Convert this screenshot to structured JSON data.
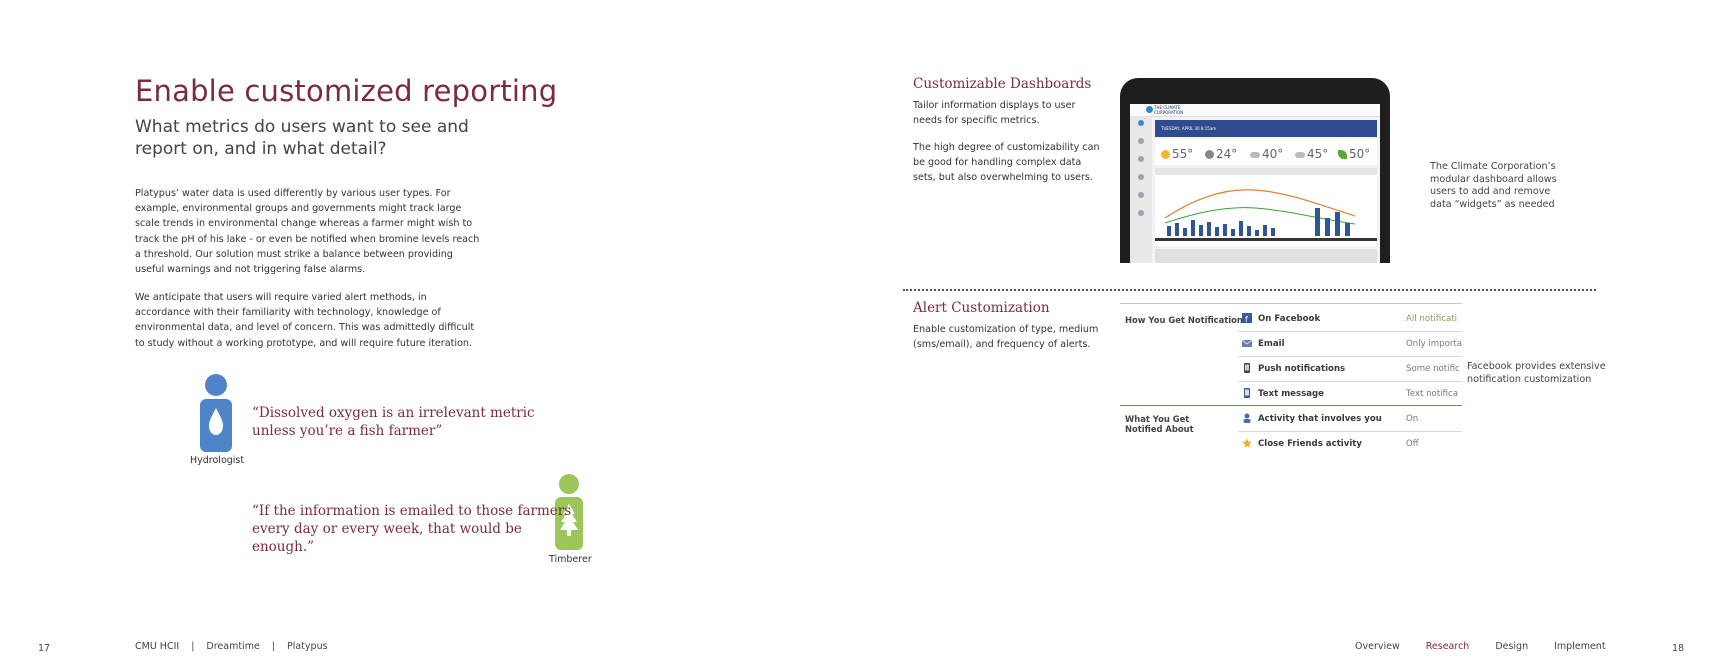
{
  "left_page": {
    "title": "Enable customized reporting",
    "subtitle": "What metrics do users want to see and report on, and in what detail?",
    "paragraph1": "Platypus’ water data is used differently by various user types. For example, environmental groups and governments might track large scale trends in environmental change whereas a farmer might wish to track the pH of his lake - or even be notified when bromine levels reach a threshold. Our solution must strike a balance between providing useful warnings and not triggering false alarms.",
    "paragraph2": "We anticipate that users will require varied alert methods, in accordance with their familiarity with technology, knowledge of environmental data, and level of concern. This was admittedly difficult to study without a working prototype, and will require future iteration.",
    "quote1": "“Dissolved oxygen is an irrelevant metric unless you’re a fish farmer”",
    "quote1_person": "Hydrologist",
    "quote2": "“If the information is emailed to those farmers every day or every week, that would be enough.”",
    "quote2_person": "Timberer",
    "page_number": "17"
  },
  "footer": {
    "path": [
      "CMU HCII",
      "Dreamtime",
      "Platypus"
    ],
    "separator": "|",
    "nav": [
      "Overview",
      "Research",
      "Design",
      "Implement"
    ],
    "active_nav": "Research",
    "right_page_number": "18"
  },
  "right_page": {
    "dashboards_title": "Customizable Dashboards",
    "dashboards_desc1": "Tailor information displays to user needs for specific metrics.",
    "dashboards_desc2": "The high degree of customizability can be good for handling complex data sets, but also overwhelming to users.",
    "dashboards_caption": "The Climate Corporation’s modular dashboard allows users to add and remove data “widgets” as needed",
    "dashboard_screen": {
      "logo": "THE CLIMATE CORPORATION",
      "banner": "TUESDAY, APRIL 30 8:15am",
      "temps": [
        "55°",
        "24°",
        "40°",
        "45°",
        "50°"
      ]
    },
    "alert_title": "Alert Customization",
    "alert_desc": "Enable customization of type, medium (sms/email), and frequency of alerts.",
    "fb_caption": "Facebook provides extensive notification customization",
    "notifications": {
      "group1_label": "How You Get Notifications",
      "group2_label": "What You Get Notified About",
      "rows": [
        {
          "label": "On Facebook",
          "value": "All notificati",
          "icon": "facebook-icon"
        },
        {
          "label": "Email",
          "value": "Only importa",
          "icon": "email-icon"
        },
        {
          "label": "Push notifications",
          "value": "Some notific",
          "icon": "phone-icon"
        },
        {
          "label": "Text message",
          "value": "Text notifica",
          "icon": "sms-icon"
        },
        {
          "label": "Activity that involves you",
          "value": "On",
          "icon": "person-icon"
        },
        {
          "label": "Close Friends activity",
          "value": "Off",
          "icon": "star-icon"
        }
      ]
    },
    "colors": {
      "accent": "#7a2c3c",
      "hydrologist": "#4f85c6",
      "timberer": "#9cc65a"
    }
  }
}
